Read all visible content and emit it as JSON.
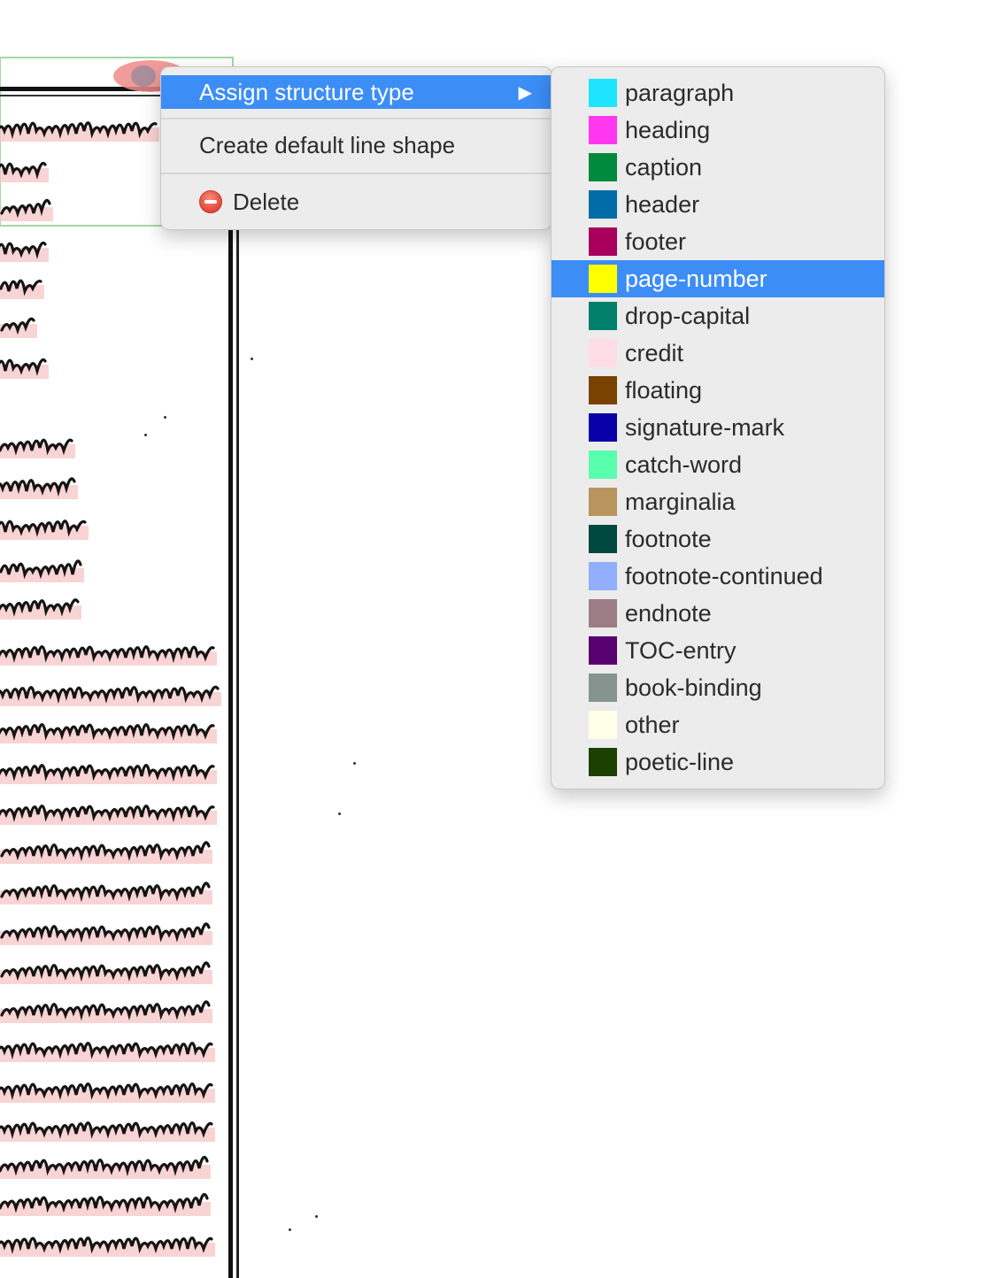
{
  "menu": {
    "items": [
      {
        "label": "Assign structure type",
        "active": true,
        "has_submenu": true
      },
      {
        "label": "Create default line shape",
        "active": false
      },
      {
        "label": "Delete",
        "active": false,
        "icon": "delete-icon"
      }
    ],
    "submenu_arrow": "▶"
  },
  "submenu": {
    "items": [
      {
        "label": "paragraph",
        "color": "#1ee4ff"
      },
      {
        "label": "heading",
        "color": "#ff38f0"
      },
      {
        "label": "caption",
        "color": "#008a3e"
      },
      {
        "label": "header",
        "color": "#006da8"
      },
      {
        "label": "footer",
        "color": "#a8005c"
      },
      {
        "label": "page-number",
        "color": "#ffff00",
        "active": true
      },
      {
        "label": "drop-capital",
        "color": "#00806a"
      },
      {
        "label": "credit",
        "color": "#ffdde6"
      },
      {
        "label": "floating",
        "color": "#7a4200"
      },
      {
        "label": "signature-mark",
        "color": "#0a00a8"
      },
      {
        "label": "catch-word",
        "color": "#5affad"
      },
      {
        "label": "marginalia",
        "color": "#b8955e"
      },
      {
        "label": "footnote",
        "color": "#00493f"
      },
      {
        "label": "footnote-continued",
        "color": "#92aefe"
      },
      {
        "label": "endnote",
        "color": "#9c7d85"
      },
      {
        "label": "TOC-entry",
        "color": "#580070"
      },
      {
        "label": "book-binding",
        "color": "#85948f"
      },
      {
        "label": "other",
        "color": "#ffffe8"
      },
      {
        "label": "poetic-line",
        "color": "#1b4000"
      }
    ]
  },
  "colors": {
    "accent": "#3c8df6",
    "menu_bg": "#ececec",
    "line_highlight": "#f7c6c6"
  }
}
